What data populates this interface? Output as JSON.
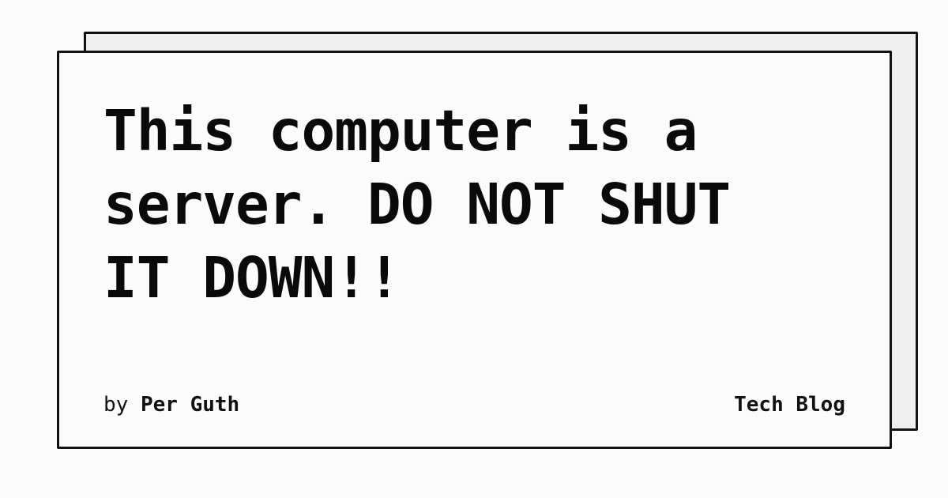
{
  "card": {
    "title": "This computer is a server. DO NOT SHUT IT DOWN!!",
    "byline_prefix": "by",
    "author": "Per Guth",
    "blog_name": "Tech Blog"
  },
  "colors": {
    "page_background": "#fcfbfa",
    "back_card": "#efefef",
    "border": "#111111",
    "text": "#0a0a0a"
  }
}
